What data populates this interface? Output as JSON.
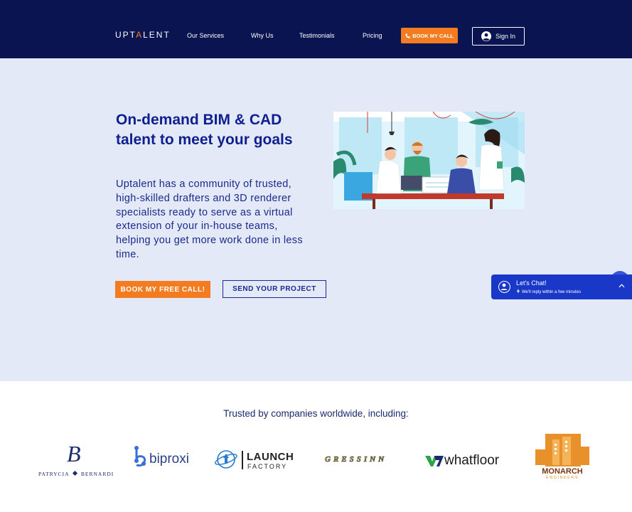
{
  "header": {
    "logo": {
      "prefix": "UPT",
      "caret": "A",
      "suffix": "LENT"
    },
    "nav": [
      "Our Services",
      "Why Us",
      "Testimonials",
      "Pricing"
    ],
    "book_call": "BOOK MY CALL",
    "sign_in": "Sign In"
  },
  "hero": {
    "title": "On-demand BIM & CAD talent to meet your goals",
    "body": "Uptalent has a community of trusted, high-skilled drafters and 3D  renderer specialists ready to serve as a virtual extension of your in-house teams, helping you get more work done in less time.",
    "primary_cta": "BOOK MY FREE CALL!",
    "secondary_cta": "SEND YOUR PROJECT"
  },
  "chat": {
    "title": "Let's Chat!",
    "subtitle": "We'll reply within a few minutes"
  },
  "trusted": {
    "heading": "Trusted by companies worldwide, including:",
    "logos": {
      "patrycia": {
        "mark": "B",
        "name": "PATRYCIA",
        "name2": "BERNARDI"
      },
      "biproxi": "biproxi",
      "launch": {
        "line1": "LAUNCH",
        "line2": "FACTORY"
      },
      "gressinn": "GRESSINN",
      "whatfloor": "whatfloor",
      "monarch": {
        "line1": "MONARCH",
        "line2": "ENGINEERS"
      }
    }
  },
  "colors": {
    "header_bg": "#0a1450",
    "accent": "#f47c20",
    "hero_bg": "#e4e9f8",
    "heading": "#0e1f8f",
    "chat_bg": "#1a38c8"
  }
}
